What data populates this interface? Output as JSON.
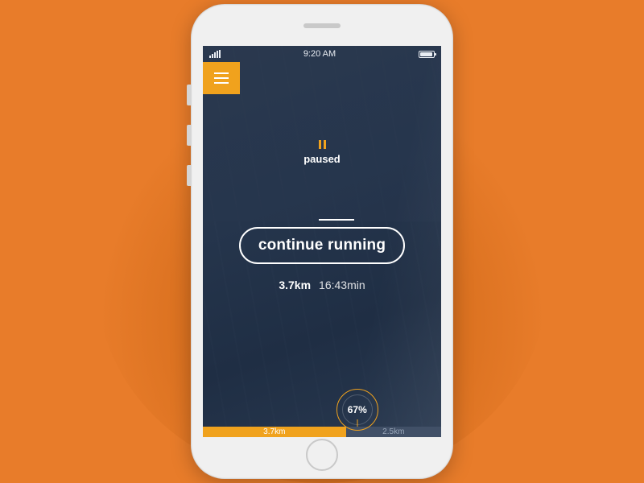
{
  "statusbar": {
    "time": "9:20 AM"
  },
  "paused": {
    "label": "paused"
  },
  "action": {
    "continue_label": "continue running"
  },
  "stats": {
    "distance": "3.7km",
    "duration": "16:43min"
  },
  "progress": {
    "percent_label": "67%",
    "done_label": "3.7km",
    "remaining_label": "2.5km"
  },
  "colors": {
    "accent": "#f0a21d",
    "bg_page": "#e87c2a",
    "screen_dark": "#25354c"
  }
}
